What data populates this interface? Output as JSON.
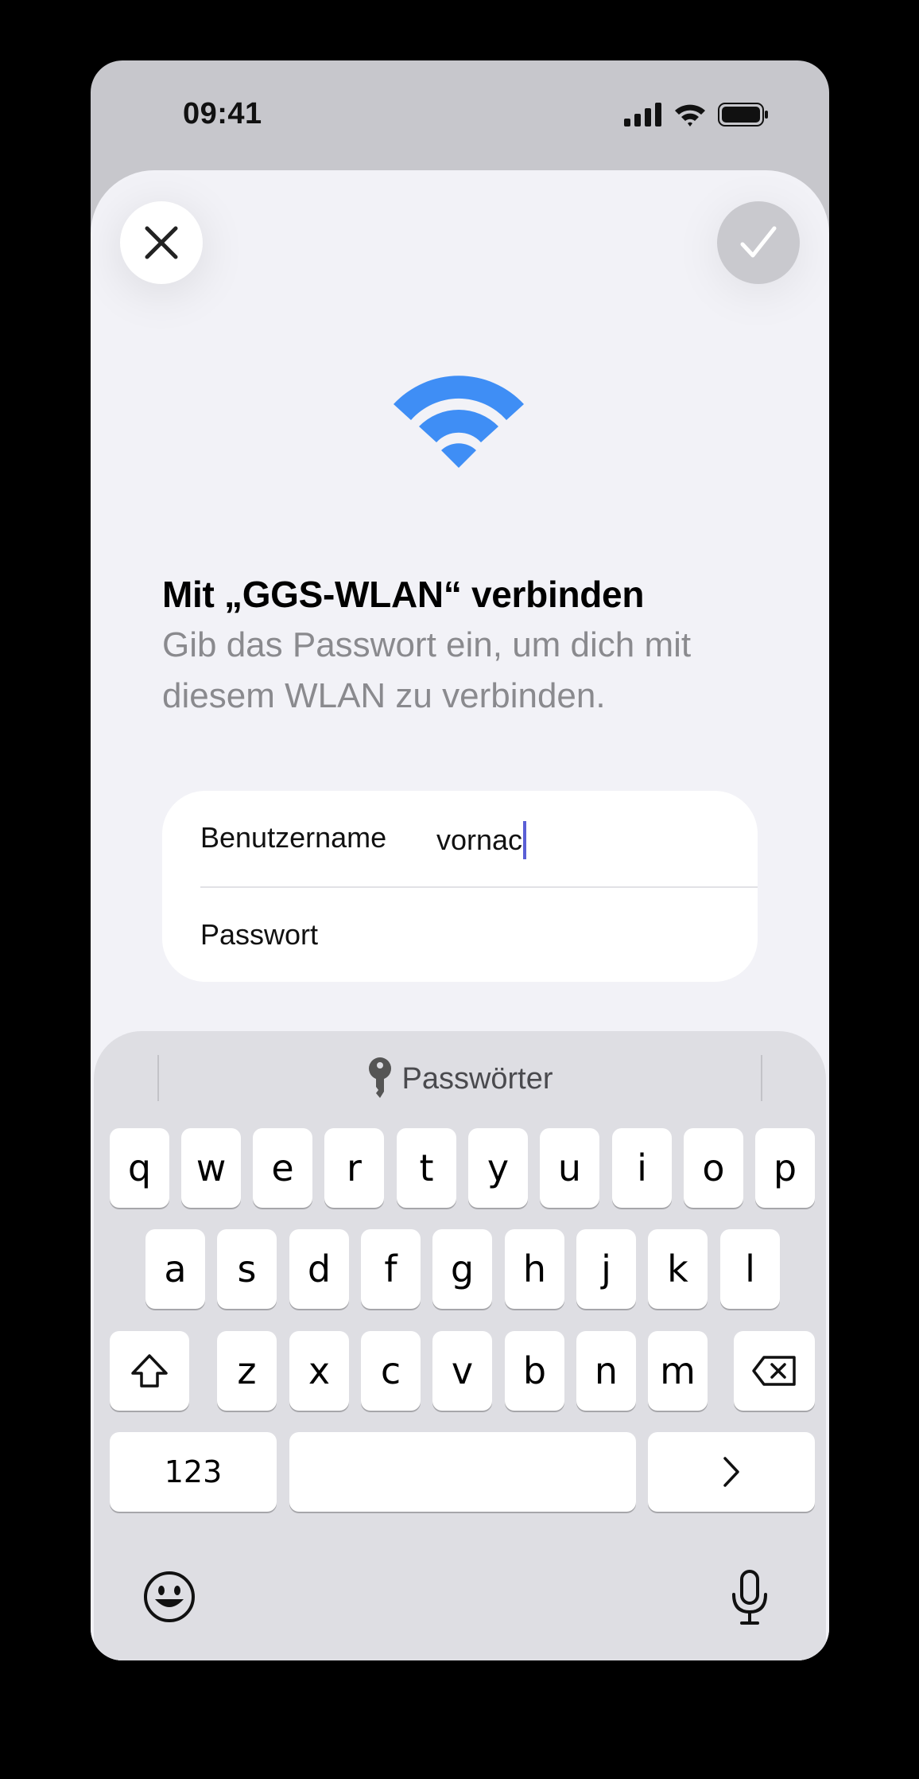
{
  "status_bar": {
    "time": "09:41",
    "icons": [
      "cellular-signal-icon",
      "wifi-icon",
      "battery-icon"
    ]
  },
  "sheet": {
    "close_icon": "close-icon",
    "confirm_icon": "checkmark-icon",
    "hero_icon": "wifi-icon",
    "title": "Mit „GGS-WLAN“ verbinden",
    "subtitle": "Gib das Passwort ein, um dich mit diesem WLAN zu verbinden."
  },
  "form": {
    "username_label": "Benutzername",
    "username_value": "vornac",
    "password_label": "Passwort",
    "password_value": ""
  },
  "keyboard": {
    "quicktype_label": "Passwörter",
    "quicktype_icon": "key-icon",
    "row1": [
      "q",
      "w",
      "e",
      "r",
      "t",
      "y",
      "u",
      "i",
      "o",
      "p"
    ],
    "row2": [
      "a",
      "s",
      "d",
      "f",
      "g",
      "h",
      "j",
      "k",
      "l"
    ],
    "row3": [
      "z",
      "x",
      "c",
      "v",
      "b",
      "n",
      "m"
    ],
    "numbers_label": "123",
    "shift_icon": "shift-icon",
    "delete_icon": "delete-icon",
    "next_icon": "chevron-right-icon",
    "emoji_icon": "emoji-icon",
    "mic_icon": "microphone-icon"
  },
  "colors": {
    "accent_blue": "#3f8ef5",
    "caret": "#5a5fd6",
    "sheet_bg": "#f2f2f7",
    "keyboard_bg": "#dedee3"
  }
}
